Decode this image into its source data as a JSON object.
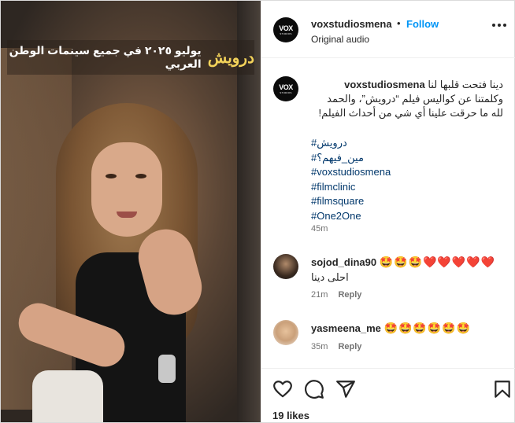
{
  "media": {
    "banner_text": "يوليو ٢٠٢٥ في جميع سينمات الوطن العربي",
    "banner_logo": "درويش"
  },
  "header": {
    "avatar_text": "VOX",
    "avatar_subtext": "STUDIOS",
    "username": "voxstudiosmena",
    "dot": "•",
    "follow_label": "Follow",
    "audio": "Original audio",
    "more_icon": "more-options-icon"
  },
  "caption": {
    "username": "voxstudiosmena",
    "lines": [
      "دينا فتحت قلبها لنا",
      "وكلمتنا عن كواليس فيلم “درويش”، والحمد",
      "لله ما حرقت علينا أي شي من أحداث الفيلم!"
    ],
    "tags": [
      "#درويش",
      "#مين_فيهم؟",
      "#voxstudiosmena",
      "#filmclinic",
      "#filmsquare",
      "#One2One"
    ],
    "time": "45m"
  },
  "comments": [
    {
      "username": "sojod_dina90",
      "emoji": "🤩🤩🤩❤️❤️❤️❤️❤️",
      "text": "احلى دينا",
      "time": "21m",
      "reply": "Reply"
    },
    {
      "username": "yasmeena_me",
      "emoji": "🤩🤩🤩🤩🤩🤩",
      "text": "",
      "time": "35m",
      "reply": "Reply"
    }
  ],
  "actions": {
    "icons": [
      "heart-icon",
      "comment-icon",
      "share-icon",
      "bookmark-icon"
    ],
    "likes": "19 likes"
  }
}
